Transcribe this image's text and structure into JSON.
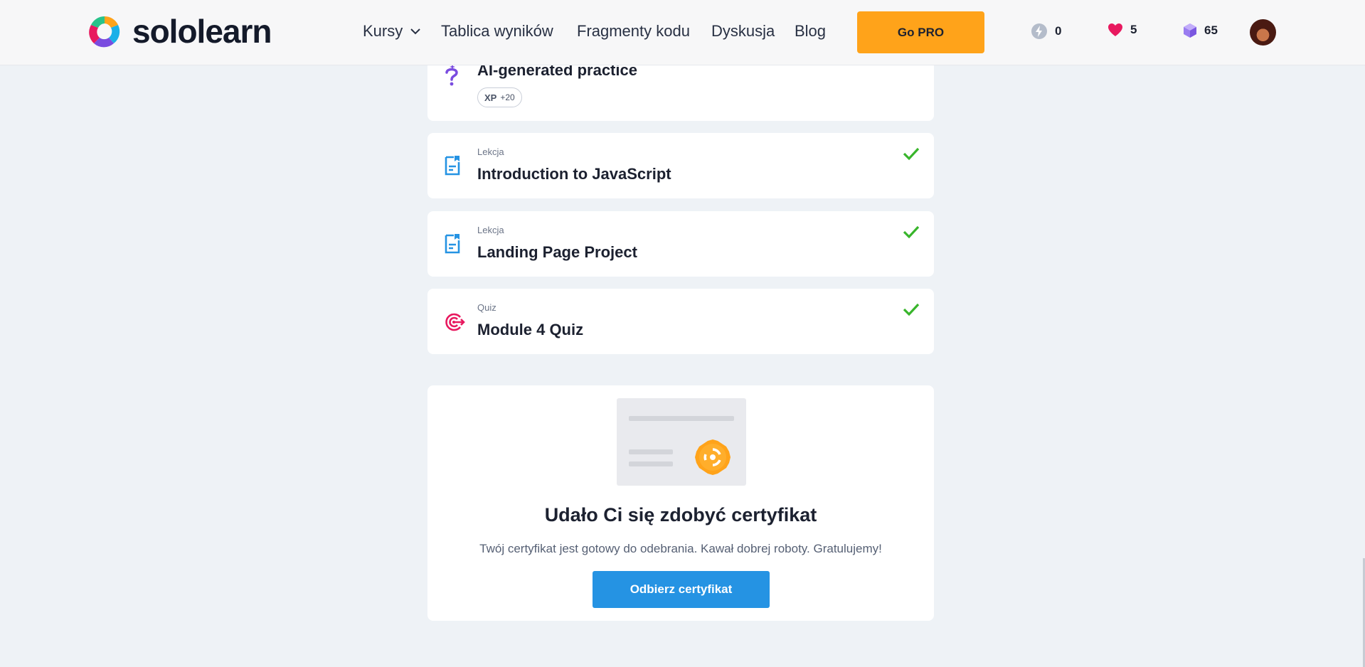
{
  "header": {
    "logo_text": "sololearn",
    "nav": {
      "courses": "Kursy",
      "leaderboard": "Tablica wyników",
      "code_snippets": "Fragmenty kodu",
      "discussion": "Dyskusja",
      "blog": "Blog"
    },
    "go_pro": "Go PRO",
    "stats": {
      "bolt": "0",
      "hearts": "5",
      "gems": "65"
    },
    "icons": [
      "chevron-down-icon",
      "bolt-icon",
      "heart-icon",
      "gem-icon"
    ]
  },
  "items": [
    {
      "type": "",
      "title": "AI-generated practice",
      "xp_label": "XP",
      "xp_value": "+20",
      "icon": "question-sparkle-icon"
    },
    {
      "type": "Lekcja",
      "title": "Introduction to JavaScript",
      "completed": true,
      "icon": "lesson-icon"
    },
    {
      "type": "Lekcja",
      "title": "Landing Page Project",
      "completed": true,
      "icon": "lesson-icon"
    },
    {
      "type": "Quiz",
      "title": "Module 4 Quiz",
      "completed": true,
      "icon": "quiz-target-icon"
    }
  ],
  "certificate": {
    "title": "Udało Ci się zdobyć certyfikat",
    "description": "Twój certyfikat jest gotowy do odebrania. Kawał dobrej roboty. Gratulujemy!",
    "button": "Odbierz certyfikat"
  },
  "colors": {
    "background": "#eef2f6",
    "accent_orange": "#ffa31a",
    "button_blue": "#2593e3",
    "check_green": "#38b52b",
    "lesson_icon_blue": "#2593e3",
    "quiz_icon_pink": "#e8195f",
    "ai_icon_purple": "#7a4ce0"
  }
}
